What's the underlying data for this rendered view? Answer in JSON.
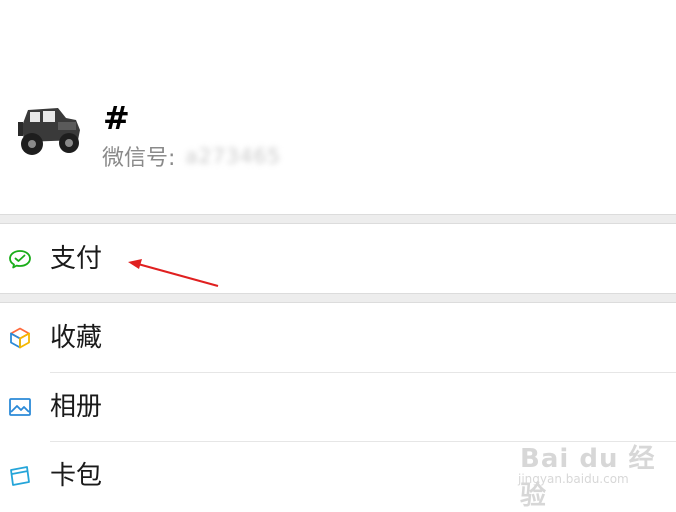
{
  "profile": {
    "name": "#",
    "wechat_id_label": "微信号:",
    "wechat_id_value": "a273465"
  },
  "menu": {
    "pay": "支付",
    "favorites": "收藏",
    "album": "相册",
    "cards": "卡包"
  },
  "icons": {
    "pay": "wallet-check-icon",
    "favorites": "cube-icon",
    "album": "photo-icon",
    "cards": "card-icon"
  },
  "colors": {
    "pay_icon": "#1aad19",
    "album_icon": "#2b8ad8",
    "cards_icon": "#25a5d9",
    "arrow": "#e02020"
  },
  "watermark": {
    "main": "Bai du 经验",
    "sub": "jingyan.baidu.com"
  }
}
